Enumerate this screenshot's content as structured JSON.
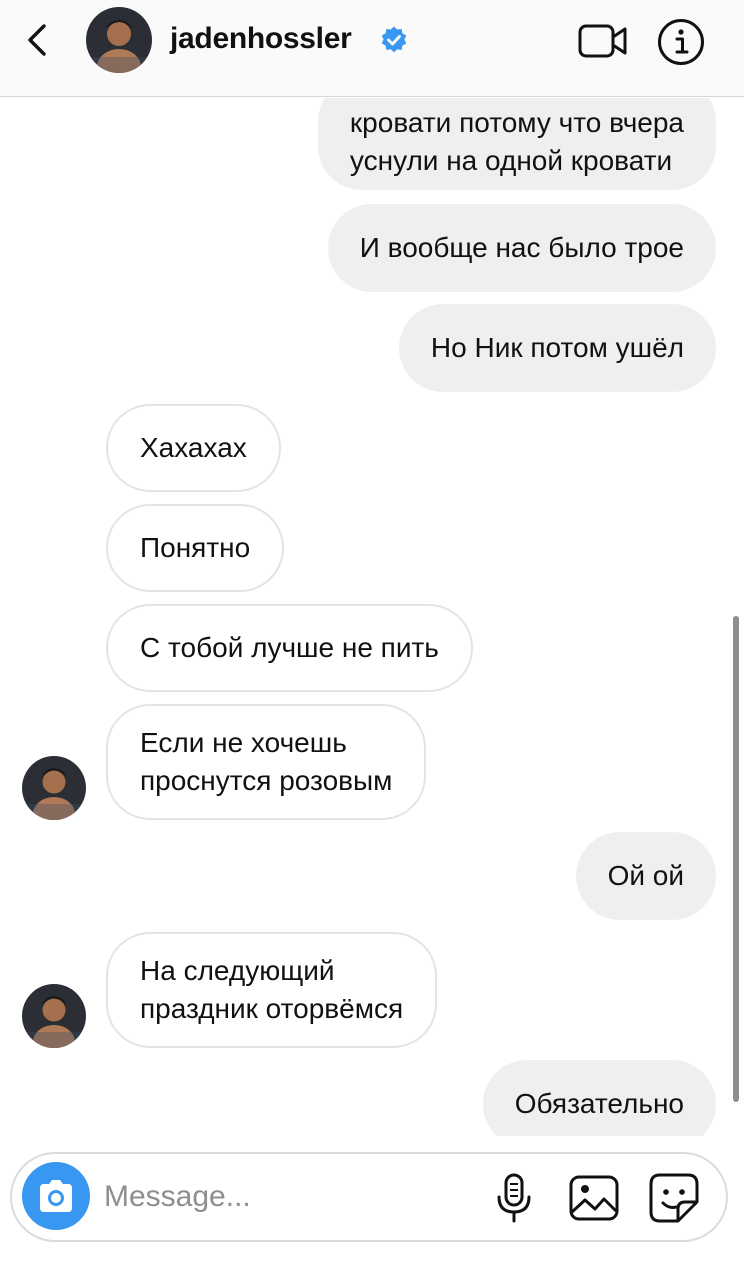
{
  "header": {
    "username": "jadenhossler",
    "verified": true,
    "back_icon": "chevron-left-icon",
    "video_icon": "video-camera-icon",
    "info_icon": "info-icon"
  },
  "messages": [
    {
      "direction": "outgoing",
      "lines": [
        "кровати потому что вчера",
        "уснули на одной кровати"
      ]
    },
    {
      "direction": "outgoing",
      "lines": [
        "И вообще нас было трое"
      ]
    },
    {
      "direction": "outgoing",
      "lines": [
        "Но Ник потом ушёл"
      ]
    },
    {
      "direction": "incoming",
      "lines": [
        "Хахахах"
      ]
    },
    {
      "direction": "incoming",
      "lines": [
        "Понятно"
      ]
    },
    {
      "direction": "incoming",
      "lines": [
        "С тобой лучше не пить"
      ]
    },
    {
      "direction": "incoming",
      "lines": [
        "Если не хочешь",
        "проснутся розовым"
      ],
      "show_avatar": true
    },
    {
      "direction": "outgoing",
      "lines": [
        "Ой ой"
      ]
    },
    {
      "direction": "incoming",
      "lines": [
        "На следующий",
        "праздник оторвёмся"
      ],
      "show_avatar": true
    },
    {
      "direction": "outgoing",
      "lines": [
        "Обязательно"
      ]
    }
  ],
  "composer": {
    "placeholder": "Message...",
    "value": "",
    "icons": [
      "camera-icon",
      "microphone-icon",
      "gallery-icon",
      "sticker-icon"
    ]
  },
  "colors": {
    "accent": "#3897f0",
    "verified_badge": "#3897f0",
    "outgoing_bubble": "#efefef",
    "incoming_border": "#e4e4e4",
    "header_bg": "#fafafa"
  }
}
